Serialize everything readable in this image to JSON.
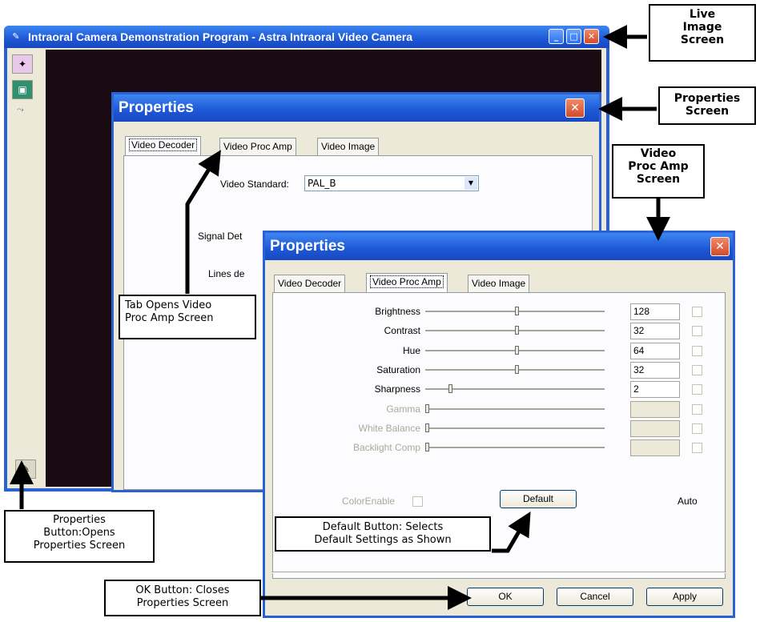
{
  "main_window": {
    "title": "Intraoral Camera Demonstration Program - Astra Intraoral Video Camera",
    "minimize_label": "_",
    "maximize_label": "□",
    "close_label": "✕"
  },
  "back_dialog": {
    "title": "Properties",
    "close_label": "✕",
    "tabs": [
      {
        "label": "Video Decoder"
      },
      {
        "label": "Video Proc Amp"
      },
      {
        "label": "Video Image"
      }
    ],
    "video_standard_label": "Video Standard:",
    "video_standard_value": "PAL_B",
    "signal_label": "Signal Det",
    "lines_label": "Lines de"
  },
  "front_dialog": {
    "title": "Properties",
    "close_label": "✕",
    "tabs": [
      {
        "label": "Video Decoder"
      },
      {
        "label": "Video Proc Amp"
      },
      {
        "label": "Video Image"
      }
    ],
    "rows": [
      {
        "label": "Brightness",
        "value": "128",
        "level": 0.5,
        "enabled": true
      },
      {
        "label": "Contrast",
        "value": "32",
        "level": 0.5,
        "enabled": true
      },
      {
        "label": "Hue",
        "value": "64",
        "level": 0.5,
        "enabled": true
      },
      {
        "label": "Saturation",
        "value": "32",
        "level": 0.5,
        "enabled": true
      },
      {
        "label": "Sharpness",
        "value": "2",
        "level": 0.13,
        "enabled": true
      },
      {
        "label": "Gamma",
        "value": "",
        "level": 0,
        "enabled": false
      },
      {
        "label": "White Balance",
        "value": "",
        "level": 0,
        "enabled": false
      },
      {
        "label": "Backlight Comp",
        "value": "",
        "level": 0,
        "enabled": false
      }
    ],
    "color_enable_label": "ColorEnable",
    "default_button": "Default",
    "auto_label": "Auto",
    "ok_button": "OK",
    "cancel_button": "Cancel",
    "apply_button": "Apply"
  },
  "callouts": {
    "live_image": [
      "Live",
      "Image",
      "Screen"
    ],
    "properties_screen": [
      "Properties",
      "Screen"
    ],
    "video_proc_amp": [
      "Video",
      "Proc Amp",
      "Screen"
    ],
    "tab_opens": [
      "Tab Opens Video",
      "Proc Amp Screen"
    ],
    "properties_button": [
      "Properties",
      "Button:Opens",
      "Properties Screen"
    ],
    "default_button_note": [
      "Default Button: Selects",
      "Default Settings as Shown"
    ],
    "ok_button_note": [
      "OK Button: Closes",
      "Properties Screen"
    ]
  }
}
